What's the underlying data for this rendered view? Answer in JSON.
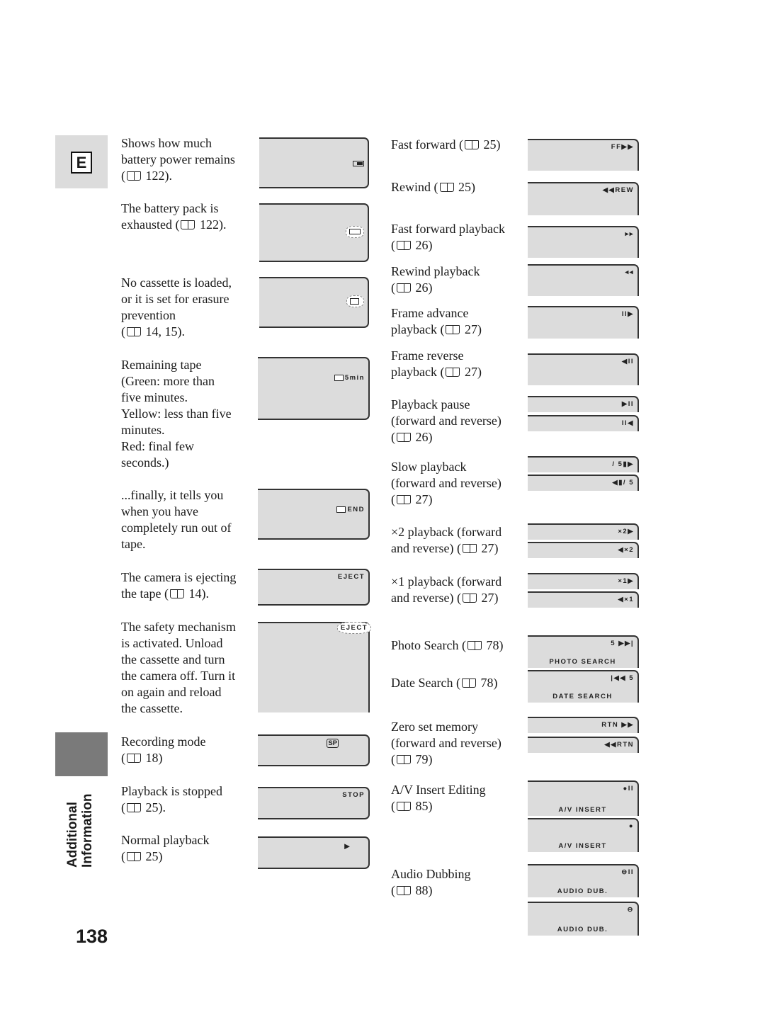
{
  "page": {
    "section_tab": "E",
    "side_label_line1": "Additional",
    "side_label_line2": "Information",
    "page_number": "138"
  },
  "left": [
    {
      "text": "Shows how much\nbattery power remains\n(",
      "ref": "122).",
      "display": {
        "top": "",
        "icon": "battery-icon"
      }
    },
    {
      "text": "The battery pack is\nexhausted (",
      "ref": "122).",
      "display": {
        "top": "",
        "icon": "battery-empty-flashing-icon"
      }
    },
    {
      "text": "No cassette is loaded,\nor it is set for erasure\nprevention\n(",
      "ref": "14, 15).",
      "display": {
        "top": "",
        "icon": "cassette-flashing-icon"
      }
    },
    {
      "text": "Remaining tape\n(Green: more than\n five minutes.\n Yellow: less than five\n minutes.\n Red: final few\n seconds.)",
      "ref": "",
      "display": {
        "top": "5min",
        "icon": "cassette-icon"
      }
    },
    {
      "text": "...finally, it tells you\nwhen you have\ncompletely run out of\ntape.",
      "ref": "",
      "display": {
        "top": "END",
        "icon": "cassette-icon"
      }
    },
    {
      "text": "The camera is ejecting\nthe tape (",
      "ref": "14).",
      "display": {
        "top": "EJECT",
        "icon": ""
      }
    },
    {
      "text": "The safety mechanism\nis activated. Unload\nthe cassette and turn\nthe camera off. Turn it\non again and reload\nthe cassette.",
      "ref": "",
      "display": {
        "top": "EJECT",
        "icon": "flashing"
      }
    },
    {
      "text": "Recording mode\n(",
      "ref": "18)",
      "display": {
        "top": "SP",
        "icon": "sp-icon"
      }
    },
    {
      "text": "Playback is stopped\n(",
      "ref": "25).",
      "display": {
        "top": "STOP",
        "icon": ""
      }
    },
    {
      "text": "Normal playback\n(",
      "ref": "25)",
      "display": {
        "top": "►",
        "icon": "play-icon"
      }
    }
  ],
  "right": [
    {
      "text": "Fast forward (",
      "ref": "25)",
      "displays": [
        {
          "top": "FF▶▶",
          "bottom": ""
        }
      ]
    },
    {
      "text": "Rewind (",
      "ref": "25)",
      "displays": [
        {
          "top": "◀◀REW",
          "bottom": ""
        }
      ]
    },
    {
      "text": "Fast forward playback\n(",
      "ref": "26)",
      "displays": [
        {
          "top": "▸▸",
          "bottom": ""
        }
      ]
    },
    {
      "text": "Rewind playback\n(",
      "ref": "26)",
      "displays": [
        {
          "top": "◂◂",
          "bottom": ""
        }
      ]
    },
    {
      "text": "Frame advance\nplayback (",
      "ref": "27)",
      "displays": [
        {
          "top": "II▶",
          "bottom": ""
        }
      ]
    },
    {
      "text": "Frame reverse\nplayback (",
      "ref": "27)",
      "displays": [
        {
          "top": "◀II",
          "bottom": ""
        }
      ]
    },
    {
      "text": "Playback pause\n(forward and reverse)\n(",
      "ref": "26)",
      "displays": [
        {
          "top": "▶II",
          "bottom": ""
        },
        {
          "top": "II◀",
          "bottom": ""
        }
      ]
    },
    {
      "text": "Slow playback\n(forward and reverse)\n(",
      "ref": "27)",
      "displays": [
        {
          "top": "/ 5▮▶",
          "bottom": ""
        },
        {
          "top": "◀▮/ 5",
          "bottom": ""
        }
      ]
    },
    {
      "text": "×2 playback (forward\nand reverse) (",
      "ref": "27)",
      "displays": [
        {
          "top": "×2▶",
          "bottom": ""
        },
        {
          "top": "◀×2",
          "bottom": ""
        }
      ]
    },
    {
      "text": "×1 playback (forward\nand reverse) (",
      "ref": "27)",
      "displays": [
        {
          "top": "×1▶",
          "bottom": ""
        },
        {
          "top": "◀×1",
          "bottom": ""
        }
      ]
    },
    {
      "text": "Photo Search (",
      "ref": "78)",
      "displays": [
        {
          "top": "5  ▶▶|",
          "bottom": "PHOTO SEARCH"
        }
      ]
    },
    {
      "text": "Date Search (",
      "ref": "78)",
      "displays": [
        {
          "top": "|◀◀  5",
          "bottom": "DATE SEARCH"
        }
      ]
    },
    {
      "text": "Zero set memory\n(forward and reverse)\n(",
      "ref": "79)",
      "displays": [
        {
          "top": "RTN ▶▶",
          "bottom": ""
        },
        {
          "top": "◀◀RTN",
          "bottom": ""
        }
      ]
    },
    {
      "text": "A/V Insert Editing\n(",
      "ref": "85)",
      "displays": [
        {
          "top": "●II",
          "bottom": "A/V  INSERT"
        },
        {
          "top": "●",
          "bottom": "A/V  INSERT"
        }
      ]
    },
    {
      "text": "Audio Dubbing\n(",
      "ref": "88)",
      "displays": [
        {
          "top": "⊖II",
          "bottom": "AUDIO DUB."
        },
        {
          "top": "⊖",
          "bottom": "AUDIO DUB."
        }
      ]
    }
  ]
}
